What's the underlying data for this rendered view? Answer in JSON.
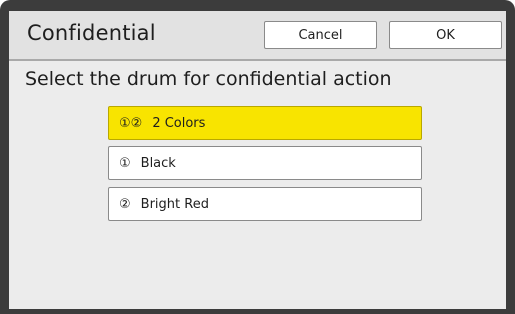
{
  "dialog": {
    "title": "Confidential",
    "cancel_label": "Cancel",
    "ok_label": "OK",
    "prompt": "Select the drum for confidential action"
  },
  "options": [
    {
      "icon": "①②",
      "label": "2 Colors",
      "selected": true
    },
    {
      "icon": "①",
      "label": "Black",
      "selected": false
    },
    {
      "icon": "②",
      "label": "Bright Red",
      "selected": false
    }
  ],
  "colors": {
    "selected_fill": "#f8e400",
    "bezel": "#3c3c3c",
    "screen_bg": "#ececec"
  }
}
